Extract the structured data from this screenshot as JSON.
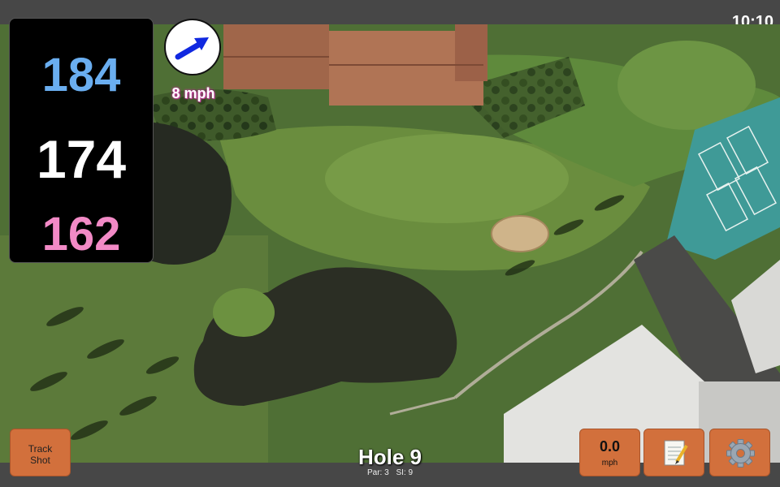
{
  "status": {
    "time": "10:10"
  },
  "distances": {
    "back": "184",
    "middle": "174",
    "front": "162"
  },
  "wind": {
    "speed_label": "8 mph",
    "direction_icon": "arrow-icon"
  },
  "hole": {
    "title": "Hole 9",
    "par": "Par: 3",
    "stroke_index": "SI: 9"
  },
  "buttons": {
    "track_shot": {
      "line1": "Track",
      "line2": "Shot"
    },
    "speed": {
      "value": "0.0",
      "unit": "mph"
    },
    "scorecard_icon": "notepad-icon",
    "settings_icon": "gear-icon"
  },
  "colors": {
    "back_distance": "#6aaef0",
    "middle_distance": "#ffffff",
    "front_distance": "#f28ac6",
    "button": "#d2703c",
    "wind_text_outline": "#c23b9a"
  }
}
